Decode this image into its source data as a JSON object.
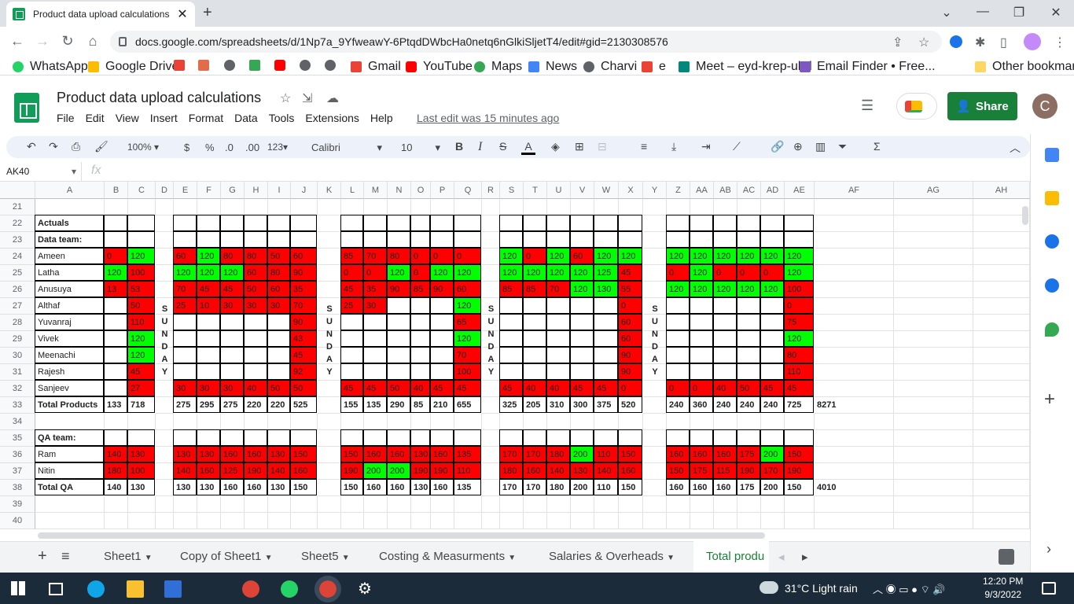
{
  "browser": {
    "tab_title": "Product data upload calculations",
    "url": "docs.google.com/spreadsheets/d/1Np7a_9YfweawY-6PtqdDWbcHa0netq6nGlkiSljetT4/edit#gid=2130308576",
    "bookmarks": [
      "WhatsApp",
      "Google Drive",
      "",
      "",
      "",
      "",
      "",
      "Gmail",
      "YouTube",
      "Maps",
      "News",
      "Charvi",
      "e",
      "Meet – eyd-krep-ubd",
      "Email Finder • Free...",
      "Other bookmarks"
    ]
  },
  "doc": {
    "title": "Product data upload calculations",
    "menus": [
      "File",
      "Edit",
      "View",
      "Insert",
      "Format",
      "Data",
      "Tools",
      "Extensions",
      "Help"
    ],
    "last_edit": "Last edit was 15 minutes ago",
    "share": "Share",
    "avatar": "C"
  },
  "toolbar": {
    "zoom": "100%",
    "currency": "$",
    "percent": "%",
    "dec_less": ".0",
    "dec_more": ".00",
    "format": "123",
    "font": "Calibri",
    "size": "10"
  },
  "namebox": "AK40",
  "fx": "fx",
  "columns": [
    "A",
    "B",
    "C",
    "D",
    "E",
    "F",
    "G",
    "H",
    "I",
    "J",
    "K",
    "L",
    "M",
    "N",
    "O",
    "P",
    "Q",
    "R",
    "S",
    "T",
    "U",
    "V",
    "W",
    "X",
    "Y",
    "Z",
    "AA",
    "AB",
    "AC",
    "AD",
    "AE",
    "AF",
    "AG",
    "AH"
  ],
  "rows": [
    "21",
    "22",
    "23",
    "24",
    "25",
    "26",
    "27",
    "28",
    "29",
    "30",
    "31",
    "32",
    "33",
    "34",
    "35",
    "36",
    "37",
    "38",
    "39",
    "40"
  ],
  "cells": {
    "r22": {
      "A": "Actuals"
    },
    "r23": {
      "A": "Data team:"
    },
    "r24": {
      "A": "Ameen",
      "B": "0",
      "C": "120",
      "E": "60",
      "F": "120",
      "G": "80",
      "H": "80",
      "I": "50",
      "J": "60",
      "L": "85",
      "M": "70",
      "N": "80",
      "O": "0",
      "P": "0",
      "Q": "0",
      "S": "120",
      "T": "0",
      "U": "120",
      "V": "60",
      "W": "120",
      "X": "120",
      "Z": "120",
      "AA": "120",
      "AB": "120",
      "AC": "120",
      "AD": "120",
      "AE": "120"
    },
    "r25": {
      "A": "Latha",
      "B": "120",
      "C": "100",
      "E": "120",
      "F": "120",
      "G": "120",
      "H": "60",
      "I": "80",
      "J": "90",
      "L": "0",
      "M": "0",
      "N": "120",
      "O": "0",
      "P": "120",
      "Q": "120",
      "S": "120",
      "T": "120",
      "U": "120",
      "V": "120",
      "W": "125",
      "X": "45",
      "Z": "0",
      "AA": "120",
      "AB": "0",
      "AC": "0",
      "AD": "0",
      "AE": "120"
    },
    "r26": {
      "A": "Anusuya",
      "B": "13",
      "C": "53",
      "E": "70",
      "F": "45",
      "G": "45",
      "H": "50",
      "I": "60",
      "J": "35",
      "L": "45",
      "M": "35",
      "N": "90",
      "O": "85",
      "P": "90",
      "Q": "60",
      "S": "85",
      "T": "85",
      "U": "70",
      "V": "120",
      "W": "130",
      "X": "55",
      "Z": "120",
      "AA": "120",
      "AB": "120",
      "AC": "120",
      "AD": "120",
      "AE": "100"
    },
    "r27": {
      "A": "Althaf",
      "C": "50",
      "E": "25",
      "F": "10",
      "G": "30",
      "H": "30",
      "I": "30",
      "J": "70",
      "L": "25",
      "M": "30",
      "Q": "120",
      "X": "0",
      "AE": "0"
    },
    "r28": {
      "A": "Yuvanraj",
      "C": "110",
      "J": "90",
      "Q": "65",
      "X": "60",
      "AE": "75"
    },
    "r29": {
      "A": "Vivek",
      "C": "120",
      "J": "43",
      "Q": "120",
      "X": "60",
      "AE": "120"
    },
    "r30": {
      "A": "Meenachi",
      "C": "120",
      "J": "45",
      "Q": "70",
      "X": "90",
      "AE": "80"
    },
    "r31": {
      "A": "Rajesh",
      "C": "45",
      "J": "92",
      "Q": "100",
      "X": "90",
      "AE": "110"
    },
    "r32": {
      "A": "Sanjeev",
      "C": "27",
      "E": "30",
      "F": "30",
      "G": "30",
      "H": "40",
      "I": "50",
      "J": "50",
      "L": "45",
      "M": "45",
      "N": "50",
      "O": "40",
      "P": "45",
      "Q": "45",
      "S": "45",
      "T": "40",
      "U": "40",
      "V": "45",
      "W": "45",
      "X": "0",
      "Z": "0",
      "AA": "0",
      "AB": "40",
      "AC": "50",
      "AD": "45",
      "AE": "45"
    },
    "r33": {
      "A": "Total Products",
      "B": "133",
      "C": "718",
      "E": "275",
      "F": "295",
      "G": "275",
      "H": "220",
      "I": "220",
      "J": "525",
      "L": "155",
      "M": "135",
      "N": "290",
      "O": "85",
      "P": "210",
      "Q": "655",
      "S": "325",
      "T": "205",
      "U": "310",
      "V": "300",
      "W": "375",
      "X": "520",
      "Z": "240",
      "AA": "360",
      "AB": "240",
      "AC": "240",
      "AD": "240",
      "AE": "725",
      "AF": "8271"
    },
    "r35": {
      "A": "QA team:"
    },
    "r36": {
      "A": "Ram",
      "B": "140",
      "C": "130",
      "E": "130",
      "F": "130",
      "G": "160",
      "H": "160",
      "I": "130",
      "J": "150",
      "L": "150",
      "M": "160",
      "N": "160",
      "O": "130",
      "P": "160",
      "Q": "135",
      "S": "170",
      "T": "170",
      "U": "180",
      "V": "200",
      "W": "110",
      "X": "150",
      "Z": "160",
      "AA": "160",
      "AB": "160",
      "AC": "175",
      "AD": "200",
      "AE": "150"
    },
    "r37": {
      "A": "Nitin",
      "B": "180",
      "C": "100",
      "E": "140",
      "F": "160",
      "G": "125",
      "H": "190",
      "I": "140",
      "J": "160",
      "L": "190",
      "M": "200",
      "N": "200",
      "O": "190",
      "P": "190",
      "Q": "110",
      "S": "180",
      "T": "160",
      "U": "140",
      "V": "130",
      "W": "140",
      "X": "160",
      "Z": "150",
      "AA": "175",
      "AB": "115",
      "AC": "190",
      "AD": "170",
      "AE": "190"
    },
    "r38": {
      "A": "Total QA",
      "B": "140",
      "C": "130",
      "E": "130",
      "F": "130",
      "G": "160",
      "H": "160",
      "I": "130",
      "J": "150",
      "L": "150",
      "M": "160",
      "N": "160",
      "O": "130",
      "P": "160",
      "Q": "135",
      "S": "170",
      "T": "170",
      "U": "180",
      "V": "200",
      "W": "110",
      "X": "150",
      "Z": "160",
      "AA": "160",
      "AB": "160",
      "AC": "175",
      "AD": "200",
      "AE": "150",
      "AF": "4010"
    }
  },
  "colors": {
    "red_bg": "#ff0000",
    "green_bg": "#00ff00"
  },
  "green_cells": {
    "r24": [
      "C",
      "F",
      "S",
      "U",
      "W",
      "X",
      "Z",
      "AA",
      "AB",
      "AC",
      "AD",
      "AE"
    ],
    "r25": [
      "B",
      "E",
      "F",
      "G",
      "N",
      "P",
      "Q",
      "S",
      "T",
      "U",
      "V",
      "W",
      "AA",
      "AE"
    ],
    "r26": [
      "V",
      "W",
      "Z",
      "AA",
      "AB",
      "AC",
      "AD"
    ],
    "r27": [
      "Q"
    ],
    "r29": [
      "C",
      "Q",
      "AE"
    ],
    "r30": [
      "C"
    ],
    "r36": [
      "V",
      "AD"
    ],
    "r37": [
      "M",
      "N"
    ]
  },
  "sunday_letters": [
    "S",
    "U",
    "N",
    "D",
    "A",
    "Y"
  ],
  "sheets": [
    "Sheet1",
    "Copy of Sheet1",
    "Sheet5",
    "Costing & Measurments",
    "Salaries & Overheads",
    "Total produ"
  ],
  "taskbar": {
    "weather": "31°C  Light rain",
    "time": "12:20 PM",
    "date": "9/3/2022"
  }
}
